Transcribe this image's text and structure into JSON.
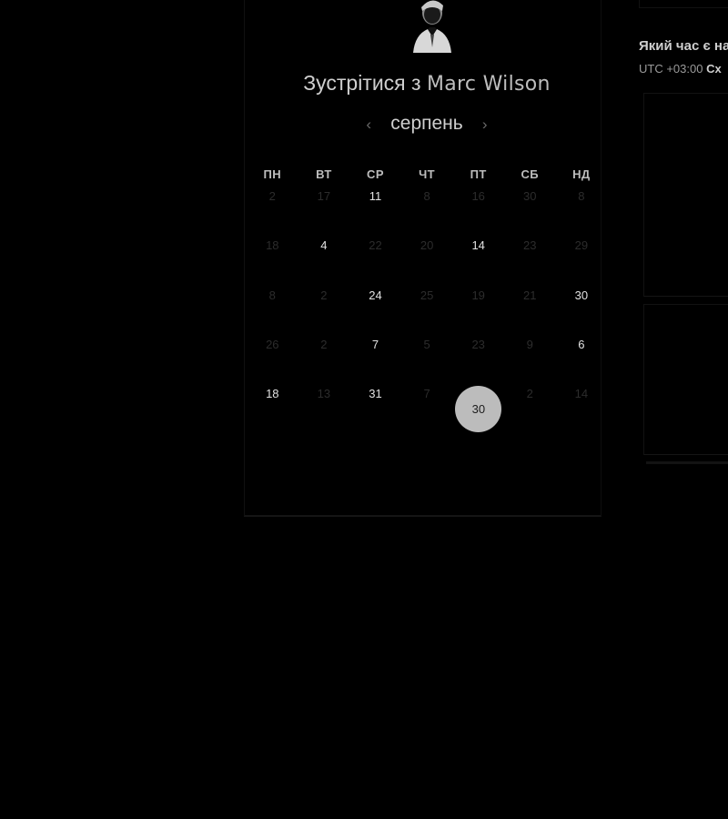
{
  "scheduler": {
    "title_prefix": "Зустрітися з",
    "host_name": "Marc Wilson",
    "month": "серпень",
    "prev_month_icon": "chevron-left-icon",
    "next_month_icon": "chevron-right-icon",
    "weekdays": [
      "ПН",
      "ВТ",
      "СР",
      "ЧТ",
      "ПТ",
      "СБ",
      "НД"
    ],
    "weeks": [
      [
        {
          "d": "2",
          "active": false
        },
        {
          "d": "17",
          "active": false
        },
        {
          "d": "11",
          "active": true
        },
        {
          "d": "8",
          "active": false
        },
        {
          "d": "16",
          "active": false
        },
        {
          "d": "30",
          "active": false
        },
        {
          "d": "8",
          "active": false
        }
      ],
      [
        {
          "d": "18",
          "active": false
        },
        {
          "d": "4",
          "active": true
        },
        {
          "d": "22",
          "active": false
        },
        {
          "d": "20",
          "active": false
        },
        {
          "d": "14",
          "active": true
        },
        {
          "d": "23",
          "active": false
        },
        {
          "d": "29",
          "active": false
        }
      ],
      [
        {
          "d": "8",
          "active": false
        },
        {
          "d": "2",
          "active": false
        },
        {
          "d": "24",
          "active": true
        },
        {
          "d": "25",
          "active": false
        },
        {
          "d": "19",
          "active": false
        },
        {
          "d": "21",
          "active": false
        },
        {
          "d": "30",
          "active": true
        }
      ],
      [
        {
          "d": "26",
          "active": false
        },
        {
          "d": "2",
          "active": false
        },
        {
          "d": "7",
          "active": true
        },
        {
          "d": "5",
          "active": false
        },
        {
          "d": "23",
          "active": false
        },
        {
          "d": "9",
          "active": false
        },
        {
          "d": "6",
          "active": true
        }
      ],
      [
        {
          "d": "18",
          "active": true
        },
        {
          "d": "13",
          "active": false
        },
        {
          "d": "31",
          "active": true
        },
        {
          "d": "7",
          "active": false
        },
        {
          "d": "30",
          "active": true,
          "selected": true
        },
        {
          "d": "2",
          "active": false
        },
        {
          "d": "14",
          "active": false
        }
      ]
    ]
  },
  "timezone": {
    "question": "Який час є на",
    "value_prefix": "UTC +03:00",
    "value_name": "Сх"
  },
  "colors": {
    "background": "#000000",
    "selected_day": "#bcbcbc",
    "active_day_text": "#e2e2e2",
    "inactive_day_text": "#2c2c2c"
  }
}
